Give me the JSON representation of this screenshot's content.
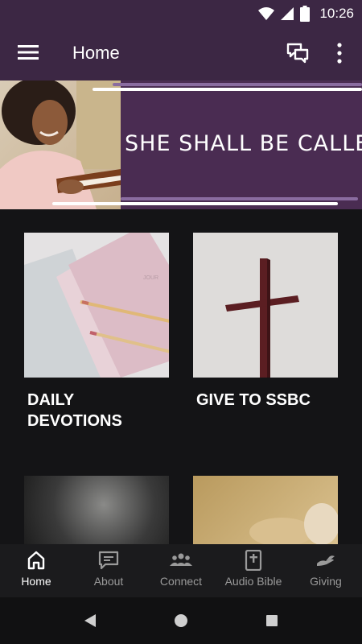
{
  "status_bar": {
    "time": "10:26",
    "icons": [
      "wifi-icon",
      "signal-icon",
      "battery-icon"
    ]
  },
  "app_bar": {
    "title": "Home",
    "icons": [
      "menu-icon",
      "chat-icon",
      "more-vert-icon"
    ]
  },
  "banner": {
    "headline": "SHE SHALL BE CALLED"
  },
  "cards": [
    {
      "label": "DAILY DEVOTIONS"
    },
    {
      "label": "GIVE TO SSBC"
    },
    {
      "label": ""
    },
    {
      "label": ""
    }
  ],
  "bottom_nav": {
    "items": [
      {
        "label": "Home",
        "icon": "home-icon",
        "active": true
      },
      {
        "label": "About",
        "icon": "about-icon",
        "active": false
      },
      {
        "label": "Connect",
        "icon": "connect-icon",
        "active": false
      },
      {
        "label": "Audio Bible",
        "icon": "bible-icon",
        "active": false
      },
      {
        "label": "Giving",
        "icon": "giving-icon",
        "active": false
      }
    ]
  },
  "colors": {
    "app_bar": "#3c2744",
    "banner": "#4a2c52",
    "background": "#141416",
    "nav_inactive": "#9a9a9a"
  }
}
